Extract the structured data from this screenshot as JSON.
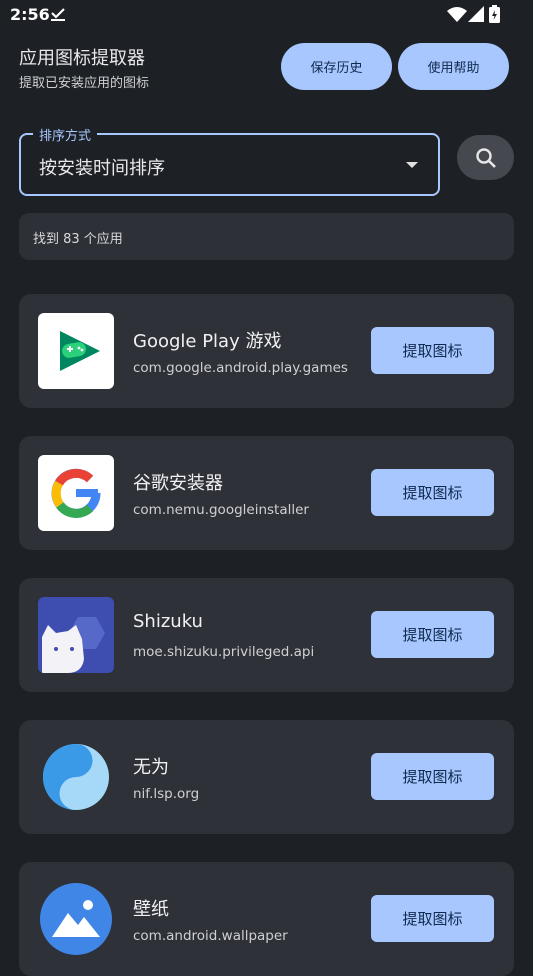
{
  "status": {
    "time": "2:56"
  },
  "header": {
    "title": "应用图标提取器",
    "subtitle": "提取已安装应用的图标"
  },
  "toolbar": {
    "history_label": "保存历史",
    "help_label": "使用帮助"
  },
  "sort": {
    "legend": "排序方式",
    "value": "按安装时间排序"
  },
  "summary": {
    "count_text": "找到 83 个应用"
  },
  "colors": {
    "accent": "#a9c7ff",
    "background": "#1d2024",
    "card": "#2e3137"
  },
  "apps": [
    {
      "name": "Google Play 游戏",
      "package": "com.google.android.play.games",
      "button": "提取图标",
      "icon": "google-play-games-icon"
    },
    {
      "name": "谷歌安装器",
      "package": "com.nemu.googleinstaller",
      "button": "提取图标",
      "icon": "google-g-icon"
    },
    {
      "name": "Shizuku",
      "package": "moe.shizuku.privileged.api",
      "button": "提取图标",
      "icon": "shizuku-icon"
    },
    {
      "name": "无为",
      "package": "nif.lsp.org",
      "button": "提取图标",
      "icon": "yin-yang-icon"
    },
    {
      "name": "壁纸",
      "package": "com.android.wallpaper",
      "button": "提取图标",
      "icon": "wallpaper-icon"
    }
  ]
}
